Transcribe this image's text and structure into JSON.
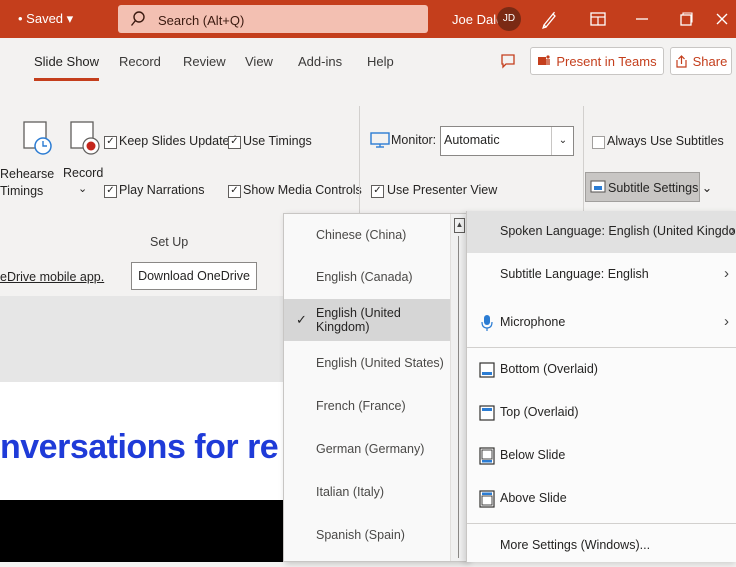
{
  "titlebar": {
    "saved_label": "• Saved ▾",
    "search_placeholder": "Search (Alt+Q)",
    "user_name": "Joe Dale",
    "user_initials": "JD"
  },
  "tabs": {
    "items": [
      "Slide Show",
      "Record",
      "Review",
      "View",
      "Add-ins",
      "Help"
    ],
    "present_in_teams": "Present in Teams",
    "share": "Share"
  },
  "ribbon": {
    "rehearse_timings": "Rehearse Timings",
    "rehearse_line1": "Rehearse",
    "rehearse_line2": "Timings",
    "record": "Record",
    "record_chevron": "⌄",
    "keep_slides_updated": "Keep Slides Updated",
    "use_timings": "Use Timings",
    "play_narrations": "Play Narrations",
    "show_media_controls": "Show Media Controls",
    "group_set_up": "Set Up",
    "monitor_label": "Monitor:",
    "monitor_value": "Automatic",
    "use_presenter_view": "Use Presenter View",
    "always_use_subtitles": "Always Use Subtitles",
    "subtitle_settings": "Subtitle Settings ⌄"
  },
  "infobar": {
    "link_text": "eDrive mobile app.",
    "download_button": "Download OneDrive"
  },
  "slide": {
    "title_fragment": "nversations for re"
  },
  "language_list": {
    "items": [
      "Chinese (China)",
      "English (Canada)",
      "English (United Kingdom)",
      "English (United States)",
      "French (France)",
      "German (Germany)",
      "Italian (Italy)",
      "Spanish (Spain)"
    ],
    "selected_index": 2
  },
  "subtitle_menu": {
    "spoken_language": "Spoken Language: English (United Kingdom)",
    "subtitle_language": "Subtitle Language: English",
    "microphone": "Microphone",
    "bottom_overlaid": "Bottom (Overlaid)",
    "top_overlaid": "Top (Overlaid)",
    "below_slide": "Below Slide",
    "above_slide": "Above Slide",
    "more_settings": "More Settings (Windows)..."
  },
  "colors": {
    "brand": "#c43e1c",
    "slide_title": "#1f3bd8",
    "presenter_icon": "#2b7cd3"
  }
}
